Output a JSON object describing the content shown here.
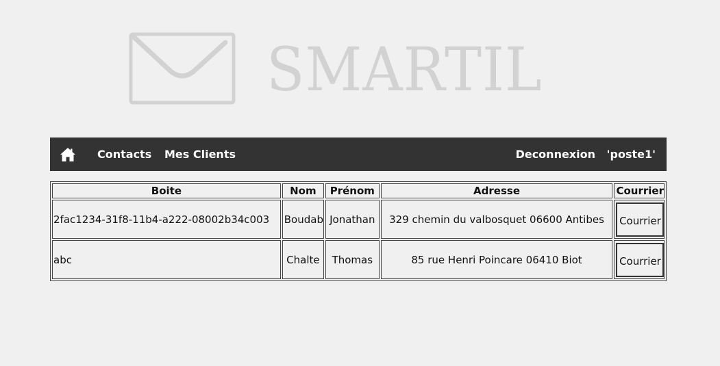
{
  "brand": {
    "name": "SMARTIL",
    "logo_icon": "envelope-icon"
  },
  "navbar": {
    "home_icon": "home-icon",
    "links": [
      {
        "label": "Contacts"
      },
      {
        "label": "Mes Clients"
      }
    ],
    "logout_label": "Deconnexion",
    "user_label": "'poste1'"
  },
  "table": {
    "headers": [
      "Boite",
      "Nom",
      "Prénom",
      "Adresse",
      "Courrier"
    ],
    "rows": [
      {
        "boite": "2fac1234-31f8-11b4-a222-08002b34c003",
        "nom": "Boudab",
        "prenom": "Jonathan",
        "adresse": "329 chemin du valbosquet 06600 Antibes",
        "courrier": "Courrier"
      },
      {
        "boite": "abc",
        "nom": "Chalte",
        "prenom": "Thomas",
        "adresse": "85 rue Henri Poincare 06410 Biot",
        "courrier": "Courrier"
      }
    ]
  },
  "colors": {
    "background": "#f0f0f0",
    "navbar": "#333333",
    "logo": "#d2d2d2"
  }
}
